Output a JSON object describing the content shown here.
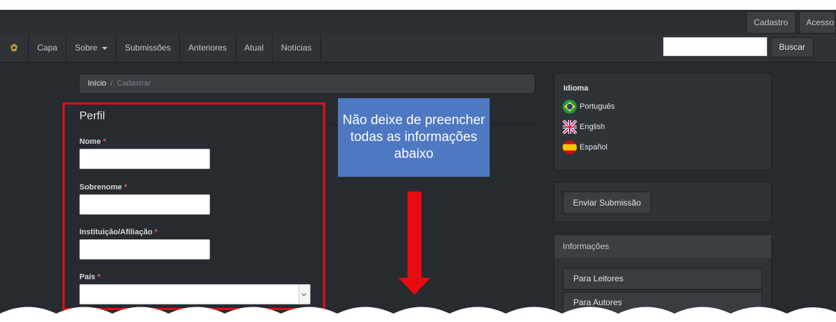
{
  "userbar": {
    "register": "Cadastro",
    "access": "Acesso"
  },
  "nav": {
    "logo_icon": "journal-logo-icon",
    "items": [
      "Capa",
      "Sobre",
      "Submissões",
      "Anteriores",
      "Atual",
      "Notícias"
    ]
  },
  "search": {
    "value": "",
    "button": "Buscar"
  },
  "breadcrumb": {
    "home": "Início",
    "separator": "/",
    "current": "Cadastrar"
  },
  "form": {
    "title": "Perfil",
    "fields": [
      {
        "label": "Nome",
        "required": "*"
      },
      {
        "label": "Sobrenome",
        "required": "*"
      },
      {
        "label": "Instituição/Afiliação",
        "required": "*"
      },
      {
        "label": "País",
        "required": "*"
      }
    ]
  },
  "callout": {
    "text": "Não deixe de preencher todas as informações abaixo"
  },
  "sidebar": {
    "language_title": "Idioma",
    "languages": [
      "Português",
      "English",
      "Español"
    ],
    "submit_button": "Enviar Submissão",
    "info_title": "Informações",
    "info_items": [
      "Para Leitores",
      "Para Autores"
    ]
  },
  "colors": {
    "background": "#272b30",
    "highlight": "#ea0b12",
    "callout": "#4e78c2"
  }
}
